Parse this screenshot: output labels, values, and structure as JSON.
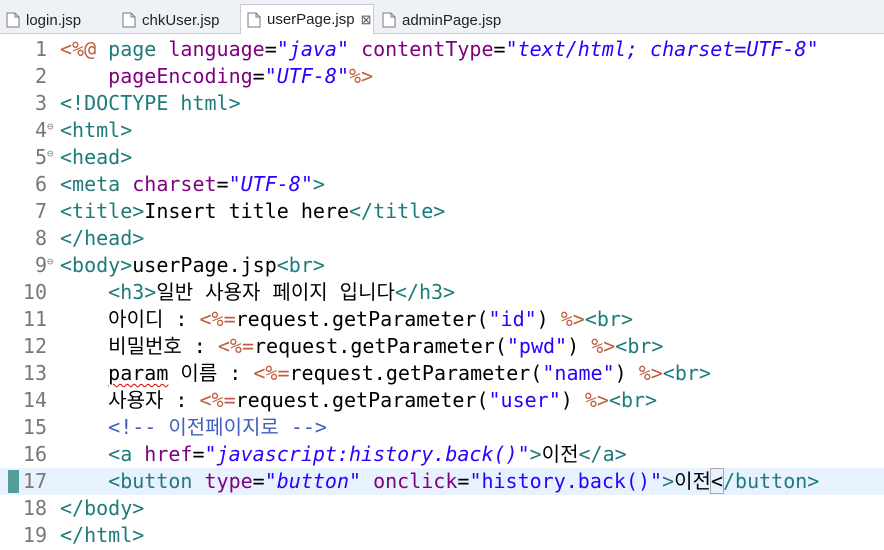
{
  "tabs": [
    {
      "label": "login.jsp",
      "active": false
    },
    {
      "label": "chkUser.jsp",
      "active": false
    },
    {
      "label": "userPage.jsp",
      "active": true
    },
    {
      "label": "adminPage.jsp",
      "active": false
    }
  ],
  "close_glyph": "⊠",
  "lines": [
    {
      "n": "1",
      "tokens": [
        [
          "jsp",
          "<%@ "
        ],
        [
          "tag",
          "page "
        ],
        [
          "attr",
          "language"
        ],
        [
          "txt",
          "="
        ],
        [
          "str",
          "\"java\""
        ],
        [
          "txt",
          " "
        ],
        [
          "attr",
          "contentType"
        ],
        [
          "txt",
          "="
        ],
        [
          "str",
          "\"text/html; charset=UTF-8\""
        ]
      ]
    },
    {
      "n": "2",
      "tokens": [
        [
          "txt",
          "    "
        ],
        [
          "attr",
          "pageEncoding"
        ],
        [
          "txt",
          "="
        ],
        [
          "str",
          "\"UTF-8\""
        ],
        [
          "jsp",
          "%>"
        ]
      ]
    },
    {
      "n": "3",
      "tokens": [
        [
          "tag",
          "<!DOCTYPE html>"
        ]
      ]
    },
    {
      "n": "4",
      "fold": true,
      "tokens": [
        [
          "tag",
          "<html>"
        ]
      ]
    },
    {
      "n": "5",
      "fold": true,
      "tokens": [
        [
          "tag",
          "<head>"
        ]
      ]
    },
    {
      "n": "6",
      "tokens": [
        [
          "tag",
          "<meta "
        ],
        [
          "attr",
          "charset"
        ],
        [
          "txt",
          "="
        ],
        [
          "str",
          "\"UTF-8\""
        ],
        [
          "tag",
          ">"
        ]
      ]
    },
    {
      "n": "7",
      "tokens": [
        [
          "tag",
          "<title>"
        ],
        [
          "txt",
          "Insert title here"
        ],
        [
          "tag",
          "</title>"
        ]
      ]
    },
    {
      "n": "8",
      "tokens": [
        [
          "tag",
          "</head>"
        ]
      ]
    },
    {
      "n": "9",
      "fold": true,
      "tokens": [
        [
          "tag",
          "<body>"
        ],
        [
          "txt",
          "userPage.jsp"
        ],
        [
          "tag",
          "<br>"
        ]
      ]
    },
    {
      "n": "10",
      "tokens": [
        [
          "txt",
          "    "
        ],
        [
          "tag",
          "<h3>"
        ],
        [
          "txt",
          "일반 사용자 페이지 입니다"
        ],
        [
          "tag",
          "</h3>"
        ]
      ]
    },
    {
      "n": "11",
      "tokens": [
        [
          "txt",
          "    아이디 : "
        ],
        [
          "jsp",
          "<%="
        ],
        [
          "txt",
          "request.getParameter("
        ],
        [
          "qs",
          "\"id\""
        ],
        [
          "txt",
          ") "
        ],
        [
          "jsp",
          "%>"
        ],
        [
          "tag",
          "<br>"
        ]
      ]
    },
    {
      "n": "12",
      "tokens": [
        [
          "txt",
          "    비밀번호 : "
        ],
        [
          "jsp",
          "<%="
        ],
        [
          "txt",
          "request.getParameter("
        ],
        [
          "qs",
          "\"pwd\""
        ],
        [
          "txt",
          ") "
        ],
        [
          "jsp",
          "%>"
        ],
        [
          "tag",
          "<br>"
        ]
      ]
    },
    {
      "n": "13",
      "tokens": [
        [
          "txt",
          "    "
        ],
        [
          "sq",
          "param"
        ],
        [
          "txt",
          " 이름 : "
        ],
        [
          "jsp",
          "<%="
        ],
        [
          "txt",
          "request.getParameter("
        ],
        [
          "qs",
          "\"name\""
        ],
        [
          "txt",
          ") "
        ],
        [
          "jsp",
          "%>"
        ],
        [
          "tag",
          "<br>"
        ]
      ]
    },
    {
      "n": "14",
      "tokens": [
        [
          "txt",
          "    사용자 : "
        ],
        [
          "jsp",
          "<%="
        ],
        [
          "txt",
          "request.getParameter("
        ],
        [
          "qs",
          "\"user\""
        ],
        [
          "txt",
          ") "
        ],
        [
          "jsp",
          "%>"
        ],
        [
          "tag",
          "<br>"
        ]
      ]
    },
    {
      "n": "15",
      "tokens": [
        [
          "txt",
          "    "
        ],
        [
          "cmt",
          "<!-- 이전페이지로 -->"
        ]
      ]
    },
    {
      "n": "16",
      "tokens": [
        [
          "txt",
          "    "
        ],
        [
          "tag",
          "<a "
        ],
        [
          "attr",
          "href"
        ],
        [
          "txt",
          "="
        ],
        [
          "str",
          "\"javascript:history.back()\""
        ],
        [
          "tag",
          ">"
        ],
        [
          "txt",
          "이전"
        ],
        [
          "tag",
          "</a>"
        ]
      ]
    },
    {
      "n": "17",
      "current": true,
      "marker": true,
      "tokens": [
        [
          "txt",
          "    "
        ],
        [
          "tag",
          "<button "
        ],
        [
          "attr",
          "type"
        ],
        [
          "txt",
          "="
        ],
        [
          "str",
          "\"button\""
        ],
        [
          "txt",
          " "
        ],
        [
          "attr",
          "onclick"
        ],
        [
          "txt",
          "="
        ],
        [
          "qs",
          "\"history.back()\""
        ],
        [
          "tag",
          ">"
        ],
        [
          "txt",
          "이전"
        ],
        [
          "brk",
          "<"
        ],
        [
          "tag",
          "/button>"
        ]
      ]
    },
    {
      "n": "18",
      "tokens": [
        [
          "tag",
          "</body>"
        ]
      ]
    },
    {
      "n": "19",
      "tokens": [
        [
          "tag",
          "</html>"
        ]
      ]
    }
  ]
}
